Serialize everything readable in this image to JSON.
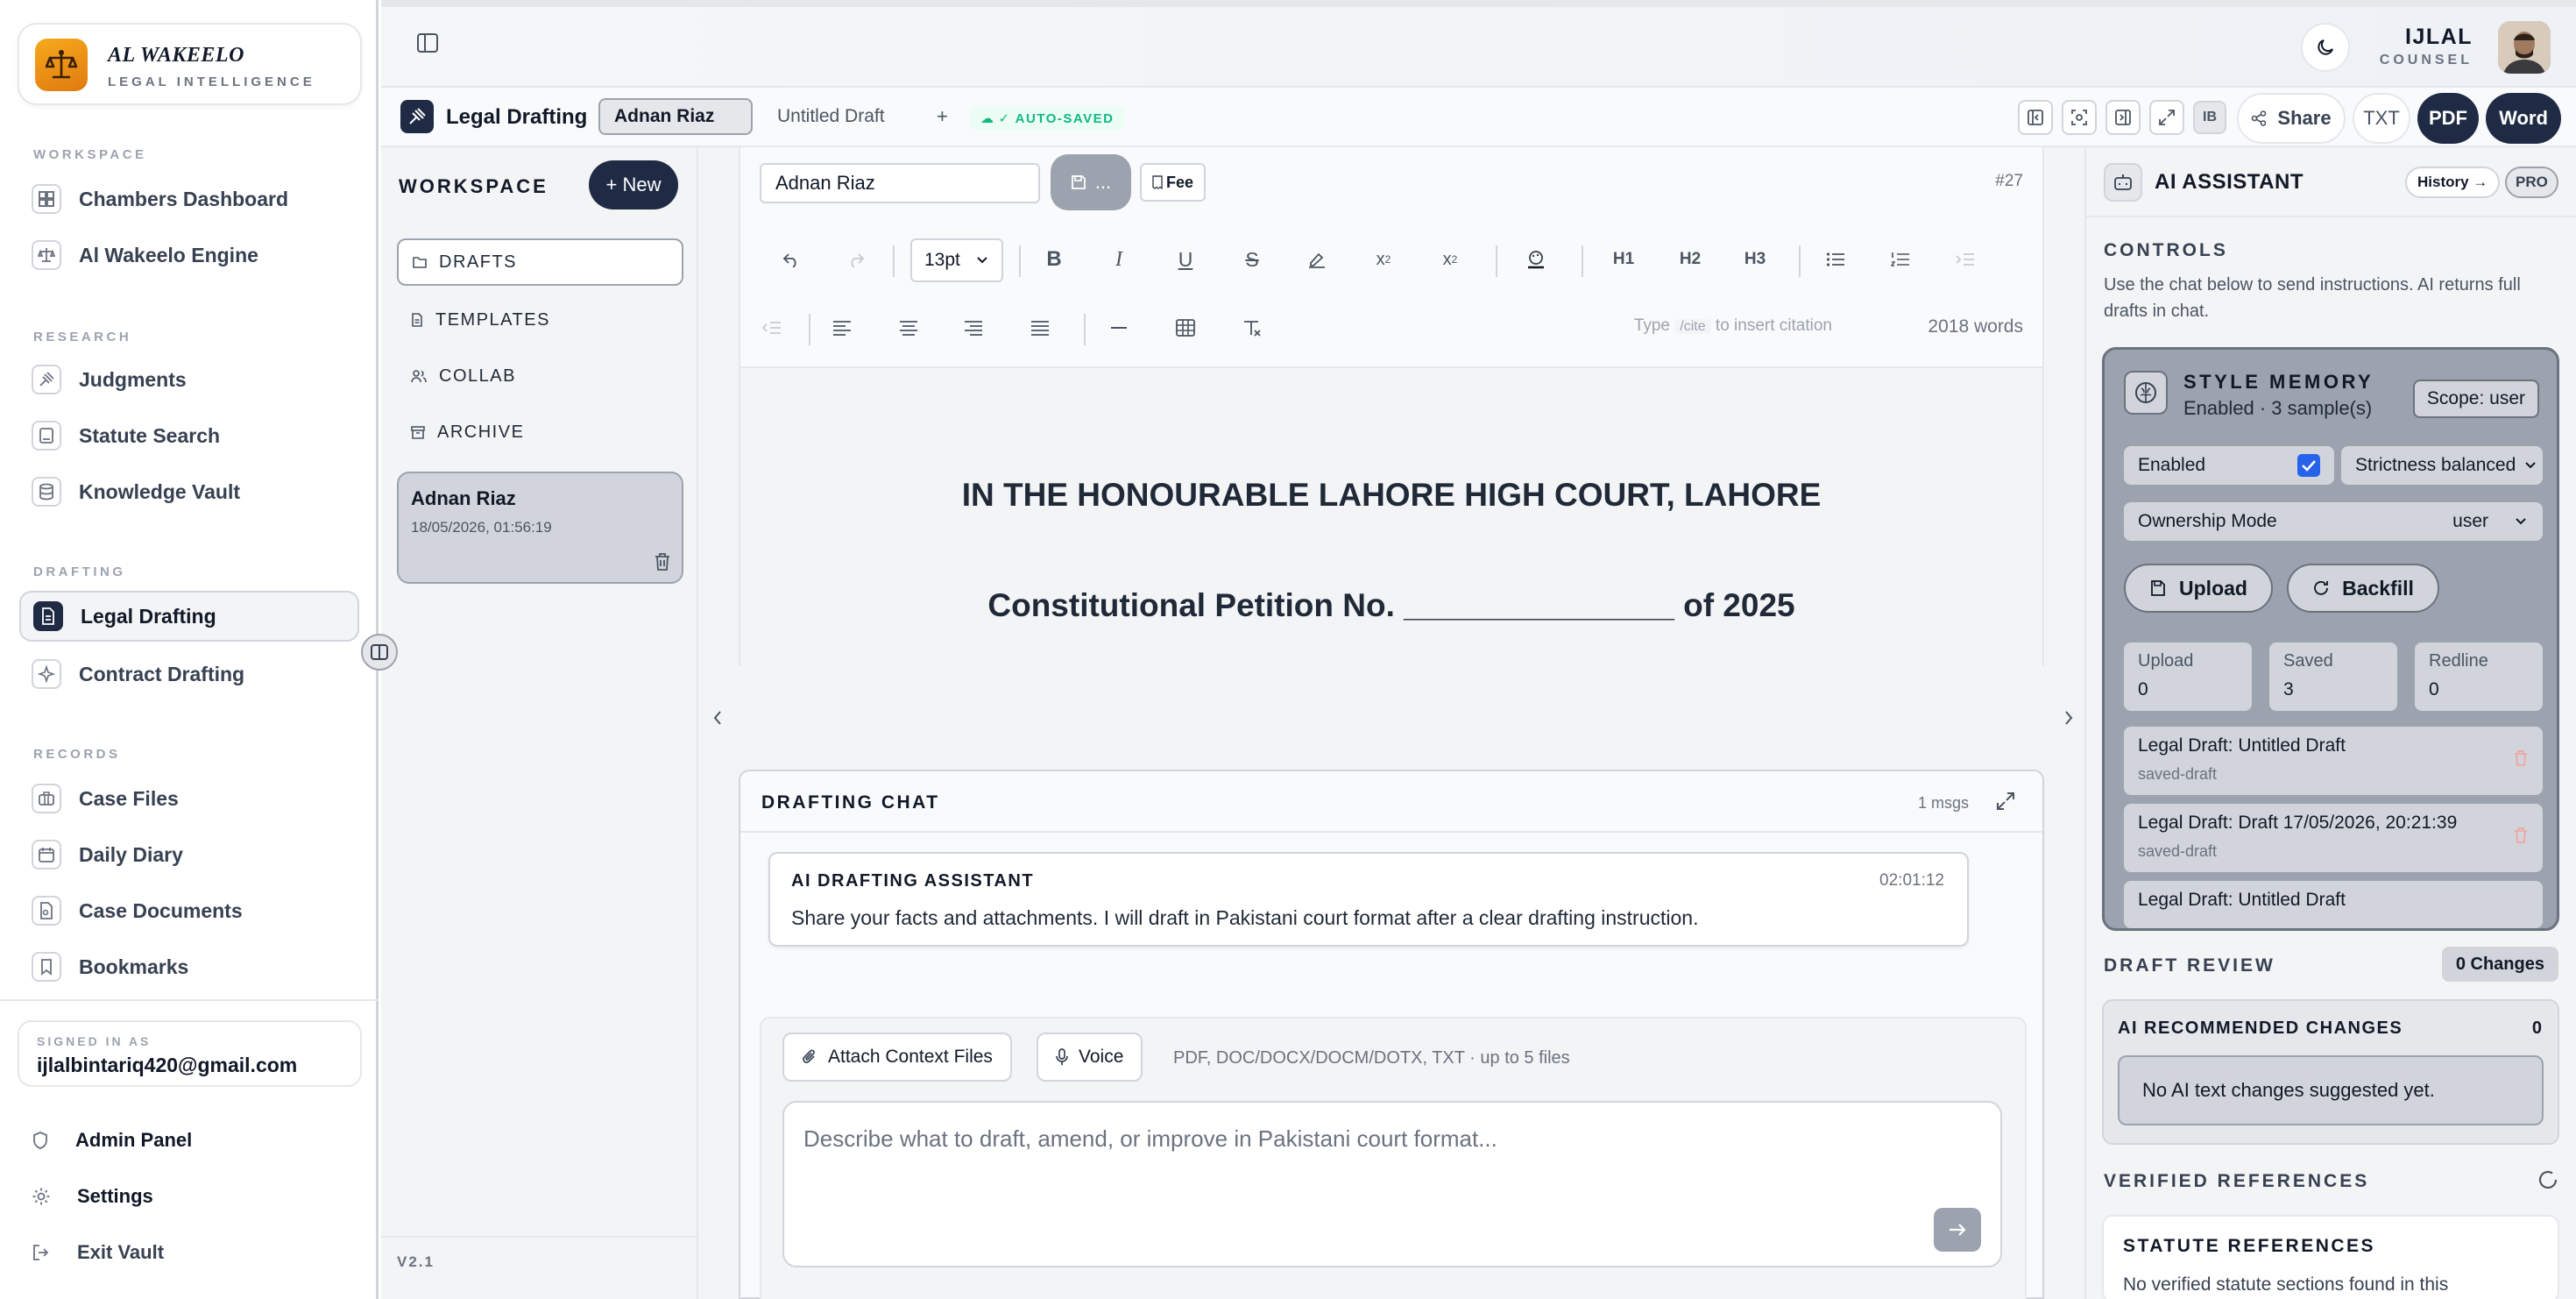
{
  "brand": {
    "name": "AL WAKEELO",
    "subtitle": "LEGAL INTELLIGENCE"
  },
  "sidebar": {
    "sections": [
      {
        "label": "WORKSPACE",
        "items": [
          {
            "label": "Chambers Dashboard",
            "icon": "grid-icon"
          },
          {
            "label": "Al Wakeelo Engine",
            "icon": "scales-icon"
          }
        ]
      },
      {
        "label": "RESEARCH",
        "items": [
          {
            "label": "Judgments",
            "icon": "gavel-icon"
          },
          {
            "label": "Statute Search",
            "icon": "book-icon"
          },
          {
            "label": "Knowledge Vault",
            "icon": "database-icon"
          }
        ]
      },
      {
        "label": "DRAFTING",
        "items": [
          {
            "label": "Legal Drafting",
            "icon": "document-icon",
            "active": true
          },
          {
            "label": "Contract Drafting",
            "icon": "sparkle-icon"
          }
        ]
      },
      {
        "label": "RECORDS",
        "items": [
          {
            "label": "Case Files",
            "icon": "briefcase-icon"
          },
          {
            "label": "Daily Diary",
            "icon": "calendar-icon"
          },
          {
            "label": "Case Documents",
            "icon": "file-icon"
          },
          {
            "label": "Bookmarks",
            "icon": "bookmark-icon"
          }
        ]
      }
    ],
    "signed_in_label": "SIGNED IN AS",
    "email": "ijlalbintariq420@gmail.com",
    "footer": [
      {
        "label": "Admin Panel",
        "icon": "shield-icon"
      },
      {
        "label": "Settings",
        "icon": "gear-icon"
      },
      {
        "label": "Exit Vault",
        "icon": "logout-icon"
      }
    ]
  },
  "user": {
    "name": "IJLAL",
    "role": "COUNSEL"
  },
  "appbar": {
    "title": "Legal Drafting",
    "tabs": [
      {
        "label": "Adnan Riaz",
        "active": true
      },
      {
        "label": "Untitled Draft",
        "active": false
      }
    ],
    "add_tab": "+",
    "autosaved": "✓ AUTO-SAVED",
    "ib": "IB",
    "share": "Share",
    "txt": "TXT",
    "pdf": "PDF",
    "word": "Word"
  },
  "workspace": {
    "title": "WORKSPACE",
    "new_button": "+ New",
    "nav": [
      {
        "label": "DRAFTS",
        "icon": "folder-icon",
        "active": true
      },
      {
        "label": "TEMPLATES",
        "icon": "file-icon"
      },
      {
        "label": "COLLAB",
        "icon": "users-icon"
      },
      {
        "label": "ARCHIVE",
        "icon": "archive-icon"
      }
    ],
    "draft": {
      "title": "Adnan Riaz",
      "date": "18/05/2026, 01:56:19"
    },
    "version": "V2.1"
  },
  "editor": {
    "doc_name": "Adnan Riaz",
    "save_more": "...",
    "fee": "Fee",
    "doc_number": "#27",
    "font_size": "13pt",
    "hint_prefix": "Type",
    "hint_code": "/cite",
    "hint_suffix": "to insert citation",
    "word_count": "2018 words",
    "heading_labels": [
      "H1",
      "H2",
      "H3"
    ],
    "court_title": "IN THE HONOURABLE LAHORE HIGH COURT, LAHORE",
    "petition": "Constitutional Petition No. _______________ of 2025"
  },
  "chat": {
    "title": "DRAFTING CHAT",
    "count": "1 msgs",
    "message": {
      "author": "AI DRAFTING ASSISTANT",
      "time": "02:01:12",
      "text": "Share your facts and attachments. I will draft in Pakistani court format after a clear drafting instruction."
    },
    "attach_label": "Attach Context Files",
    "voice_label": "Voice",
    "file_note": "PDF, DOC/DOCX/DOCM/DOTX, TXT · up to 5 files",
    "placeholder": "Describe what to draft, amend, or improve in Pakistani court format..."
  },
  "assistant": {
    "title": "AI ASSISTANT",
    "history": "History →",
    "pro": "PRO",
    "controls_label": "CONTROLS",
    "controls_desc": "Use the chat below to send instructions. AI returns full drafts in chat.",
    "style_memory": {
      "title": "STYLE MEMORY",
      "status": "Enabled · 3 sample(s)",
      "scope": "Scope: user",
      "enabled_label": "Enabled",
      "strictness": "Strictness balanced",
      "ownership_label": "Ownership Mode",
      "ownership_value": "user",
      "upload_button": "Upload",
      "backfill_button": "Backfill",
      "stats": [
        {
          "label": "Upload",
          "value": "0"
        },
        {
          "label": "Saved",
          "value": "3"
        },
        {
          "label": "Redline",
          "value": "0"
        }
      ],
      "items": [
        {
          "title": "Legal Draft: Untitled Draft",
          "tag": "saved-draft"
        },
        {
          "title": "Legal Draft: Draft 17/05/2026, 20:21:39",
          "tag": "saved-draft"
        },
        {
          "title": "Legal Draft: Untitled Draft",
          "tag": ""
        }
      ]
    },
    "review_label": "DRAFT REVIEW",
    "changes_badge": "0 Changes",
    "recommended_title": "AI RECOMMENDED CHANGES",
    "recommended_count": "0",
    "recommended_empty": "No AI text changes suggested yet.",
    "verified_label": "VERIFIED REFERENCES",
    "statute_title": "STATUTE REFERENCES",
    "statute_text": "No verified statute sections found in this"
  }
}
